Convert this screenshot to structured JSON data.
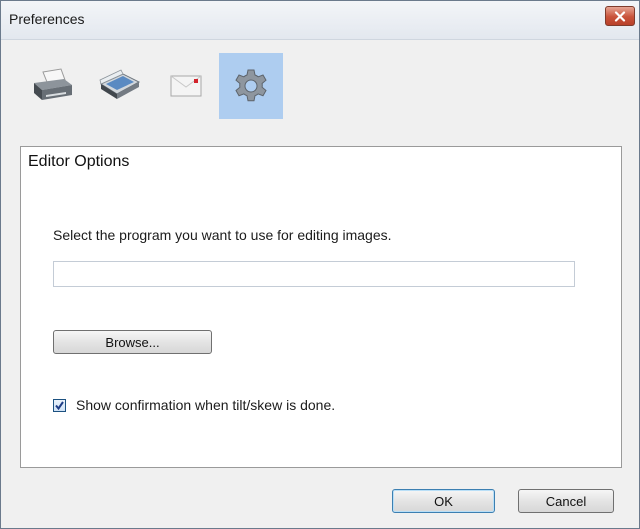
{
  "window": {
    "title": "Preferences",
    "close_icon": "close-icon"
  },
  "toolbar": {
    "tools": [
      {
        "name": "printer-icon",
        "selected": false
      },
      {
        "name": "scanner-icon",
        "selected": false
      },
      {
        "name": "mail-icon",
        "selected": false
      },
      {
        "name": "gear-icon",
        "selected": true
      }
    ]
  },
  "panel": {
    "title": "Editor Options",
    "instruction": "Select the program you want to use for editing images.",
    "editor_path": {
      "value": "",
      "placeholder": ""
    },
    "browse_label": "Browse...",
    "checkbox": {
      "label": "Show confirmation when tilt/skew is done.",
      "checked": true
    }
  },
  "footer": {
    "ok_label": "OK",
    "cancel_label": "Cancel"
  },
  "colors": {
    "selection": "#aecdf0",
    "close": "#c9533a",
    "panel_bg": "#ffffff",
    "window_bg": "#f0f0f0"
  }
}
